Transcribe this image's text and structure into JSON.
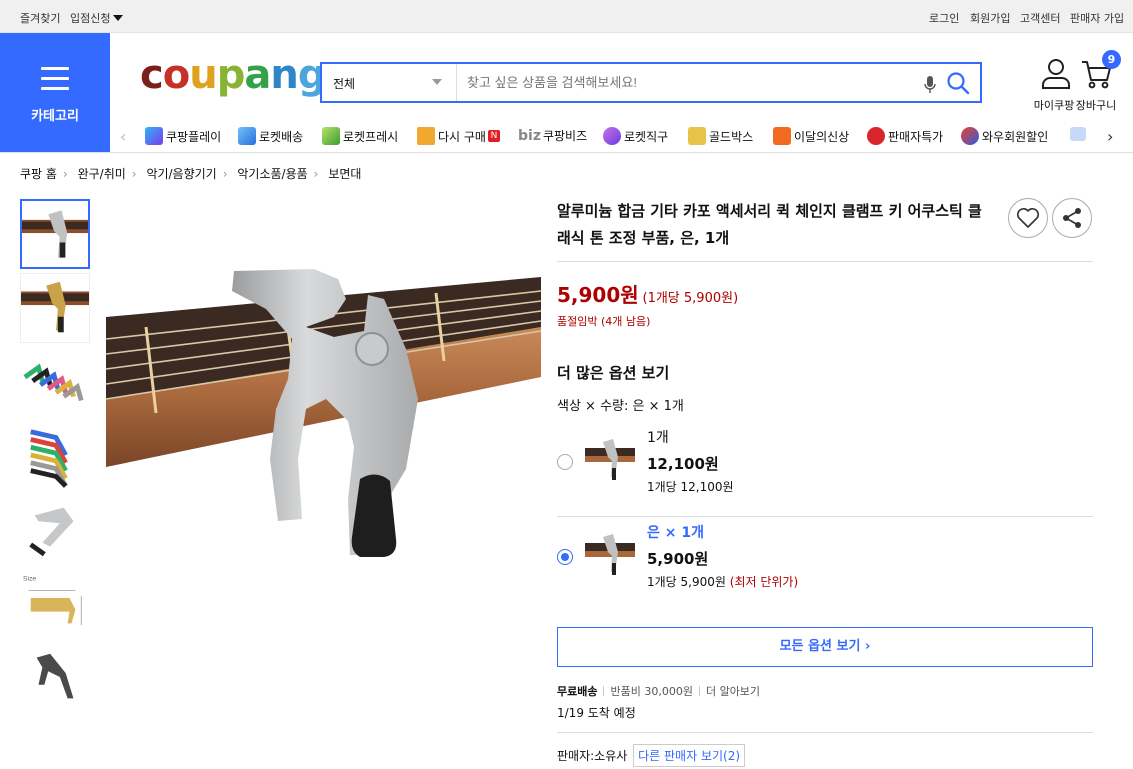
{
  "topbar": {
    "bookmark": "즐겨찾기",
    "seller_apply": "입점신청",
    "login": "로그인",
    "signup": "회원가입",
    "customer_center": "고객센터",
    "seller_signup": "판매자 가입"
  },
  "category_button": {
    "label": "카테고리"
  },
  "logo": {
    "text": "coupang"
  },
  "search": {
    "category": "전체",
    "placeholder": "찾고 싶은 상품을 검색해보세요!"
  },
  "utility": {
    "mycoupang": "마이쿠팡",
    "cart": "장바구니",
    "cart_count": "9"
  },
  "nav": {
    "items": [
      {
        "label": "쿠팡플레이",
        "icon": "play-icon"
      },
      {
        "label": "로켓배송",
        "icon": "rocket-icon"
      },
      {
        "label": "로켓프레시",
        "icon": "rocket-fresh-icon"
      },
      {
        "label": "다시 구매",
        "icon": "rebuy-icon",
        "badge": "N"
      },
      {
        "label": "쿠팡비즈",
        "icon": "biz-icon",
        "prefix": "biz"
      },
      {
        "label": "로켓직구",
        "icon": "global-icon"
      },
      {
        "label": "골드박스",
        "icon": "goldbox-icon"
      },
      {
        "label": "이달의신상",
        "icon": "new-icon"
      },
      {
        "label": "판매자특가",
        "icon": "percent-icon"
      },
      {
        "label": "와우회원할인",
        "icon": "wow-icon"
      }
    ]
  },
  "breadcrumb": [
    "쿠팡 홈",
    "완구/취미",
    "악기/음향기기",
    "악기소품/용품",
    "보면대"
  ],
  "product": {
    "title": "알루미늄 합금 기타 카포 액세서리 퀵 체인지 클램프 키 어쿠스틱 클래식 톤 조정 부품, 은, 1개",
    "price": "5,900원",
    "unit_price": "(1개당 5,900원)",
    "stock_note": "품절임박 (4개 남음)",
    "more_options_title": "더 많은 옵션 보기",
    "selected_option": "색상 × 수량: 은 × 1개",
    "options": [
      {
        "name": "1개",
        "price": "12,100원",
        "unit": "1개당 12,100원",
        "note": "",
        "selected": false
      },
      {
        "name": "은 × 1개",
        "price": "5,900원",
        "unit": "1개당 5,900원",
        "note": "(최저 단위가)",
        "selected": true
      }
    ],
    "all_options_label": "모든 옵션 보기",
    "shipping": {
      "free": "무료배송",
      "return_fee": "반품비 30,000원",
      "more": "더 알아보기",
      "arrival": "1/19 도착 예정"
    },
    "seller": {
      "label": "판매자:",
      "name": "소유사",
      "other_sellers": "다른 판매자 보기(2)"
    }
  },
  "colors": {
    "accent": "#346aff",
    "price_red": "#ae0000"
  }
}
